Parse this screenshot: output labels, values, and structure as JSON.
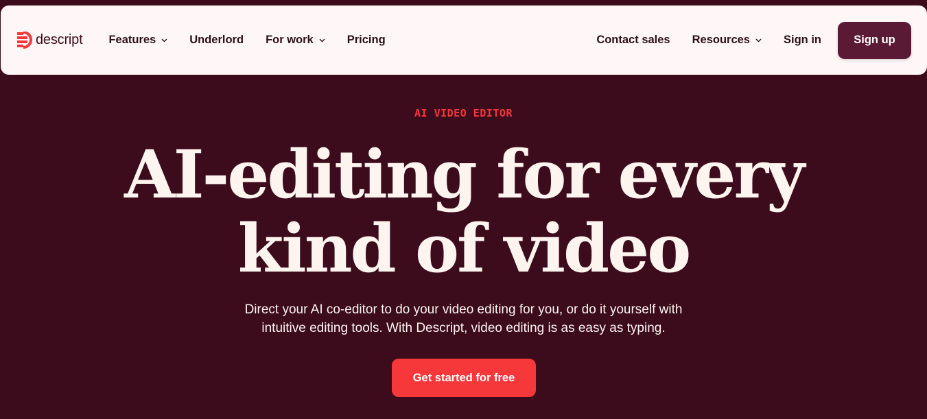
{
  "brand": {
    "name": "descript",
    "logo_icon": "descript-logo-icon",
    "color": "#f6383b"
  },
  "nav": {
    "left": [
      {
        "label": "Features",
        "has_dropdown": true
      },
      {
        "label": "Underlord",
        "has_dropdown": false
      },
      {
        "label": "For work",
        "has_dropdown": true
      },
      {
        "label": "Pricing",
        "has_dropdown": false
      }
    ],
    "right": [
      {
        "label": "Contact sales",
        "has_dropdown": false
      },
      {
        "label": "Resources",
        "has_dropdown": true
      },
      {
        "label": "Sign in",
        "has_dropdown": false
      }
    ],
    "signup_label": "Sign up"
  },
  "hero": {
    "eyebrow": "AI VIDEO EDITOR",
    "headline_line1": "AI-editing for every",
    "headline_line2": "kind of video",
    "subtext_line1": "Direct your AI co-editor to do your video editing for you, or do it yourself with",
    "subtext_line2": "intuitive editing tools. With Descript, video editing is as easy as typing.",
    "cta_label": "Get started for free"
  },
  "colors": {
    "background": "#3c0c1c",
    "navbar": "#fff6f7",
    "signup_button": "#5a1a36",
    "accent": "#f6383b",
    "headline": "#fdf4ef"
  }
}
